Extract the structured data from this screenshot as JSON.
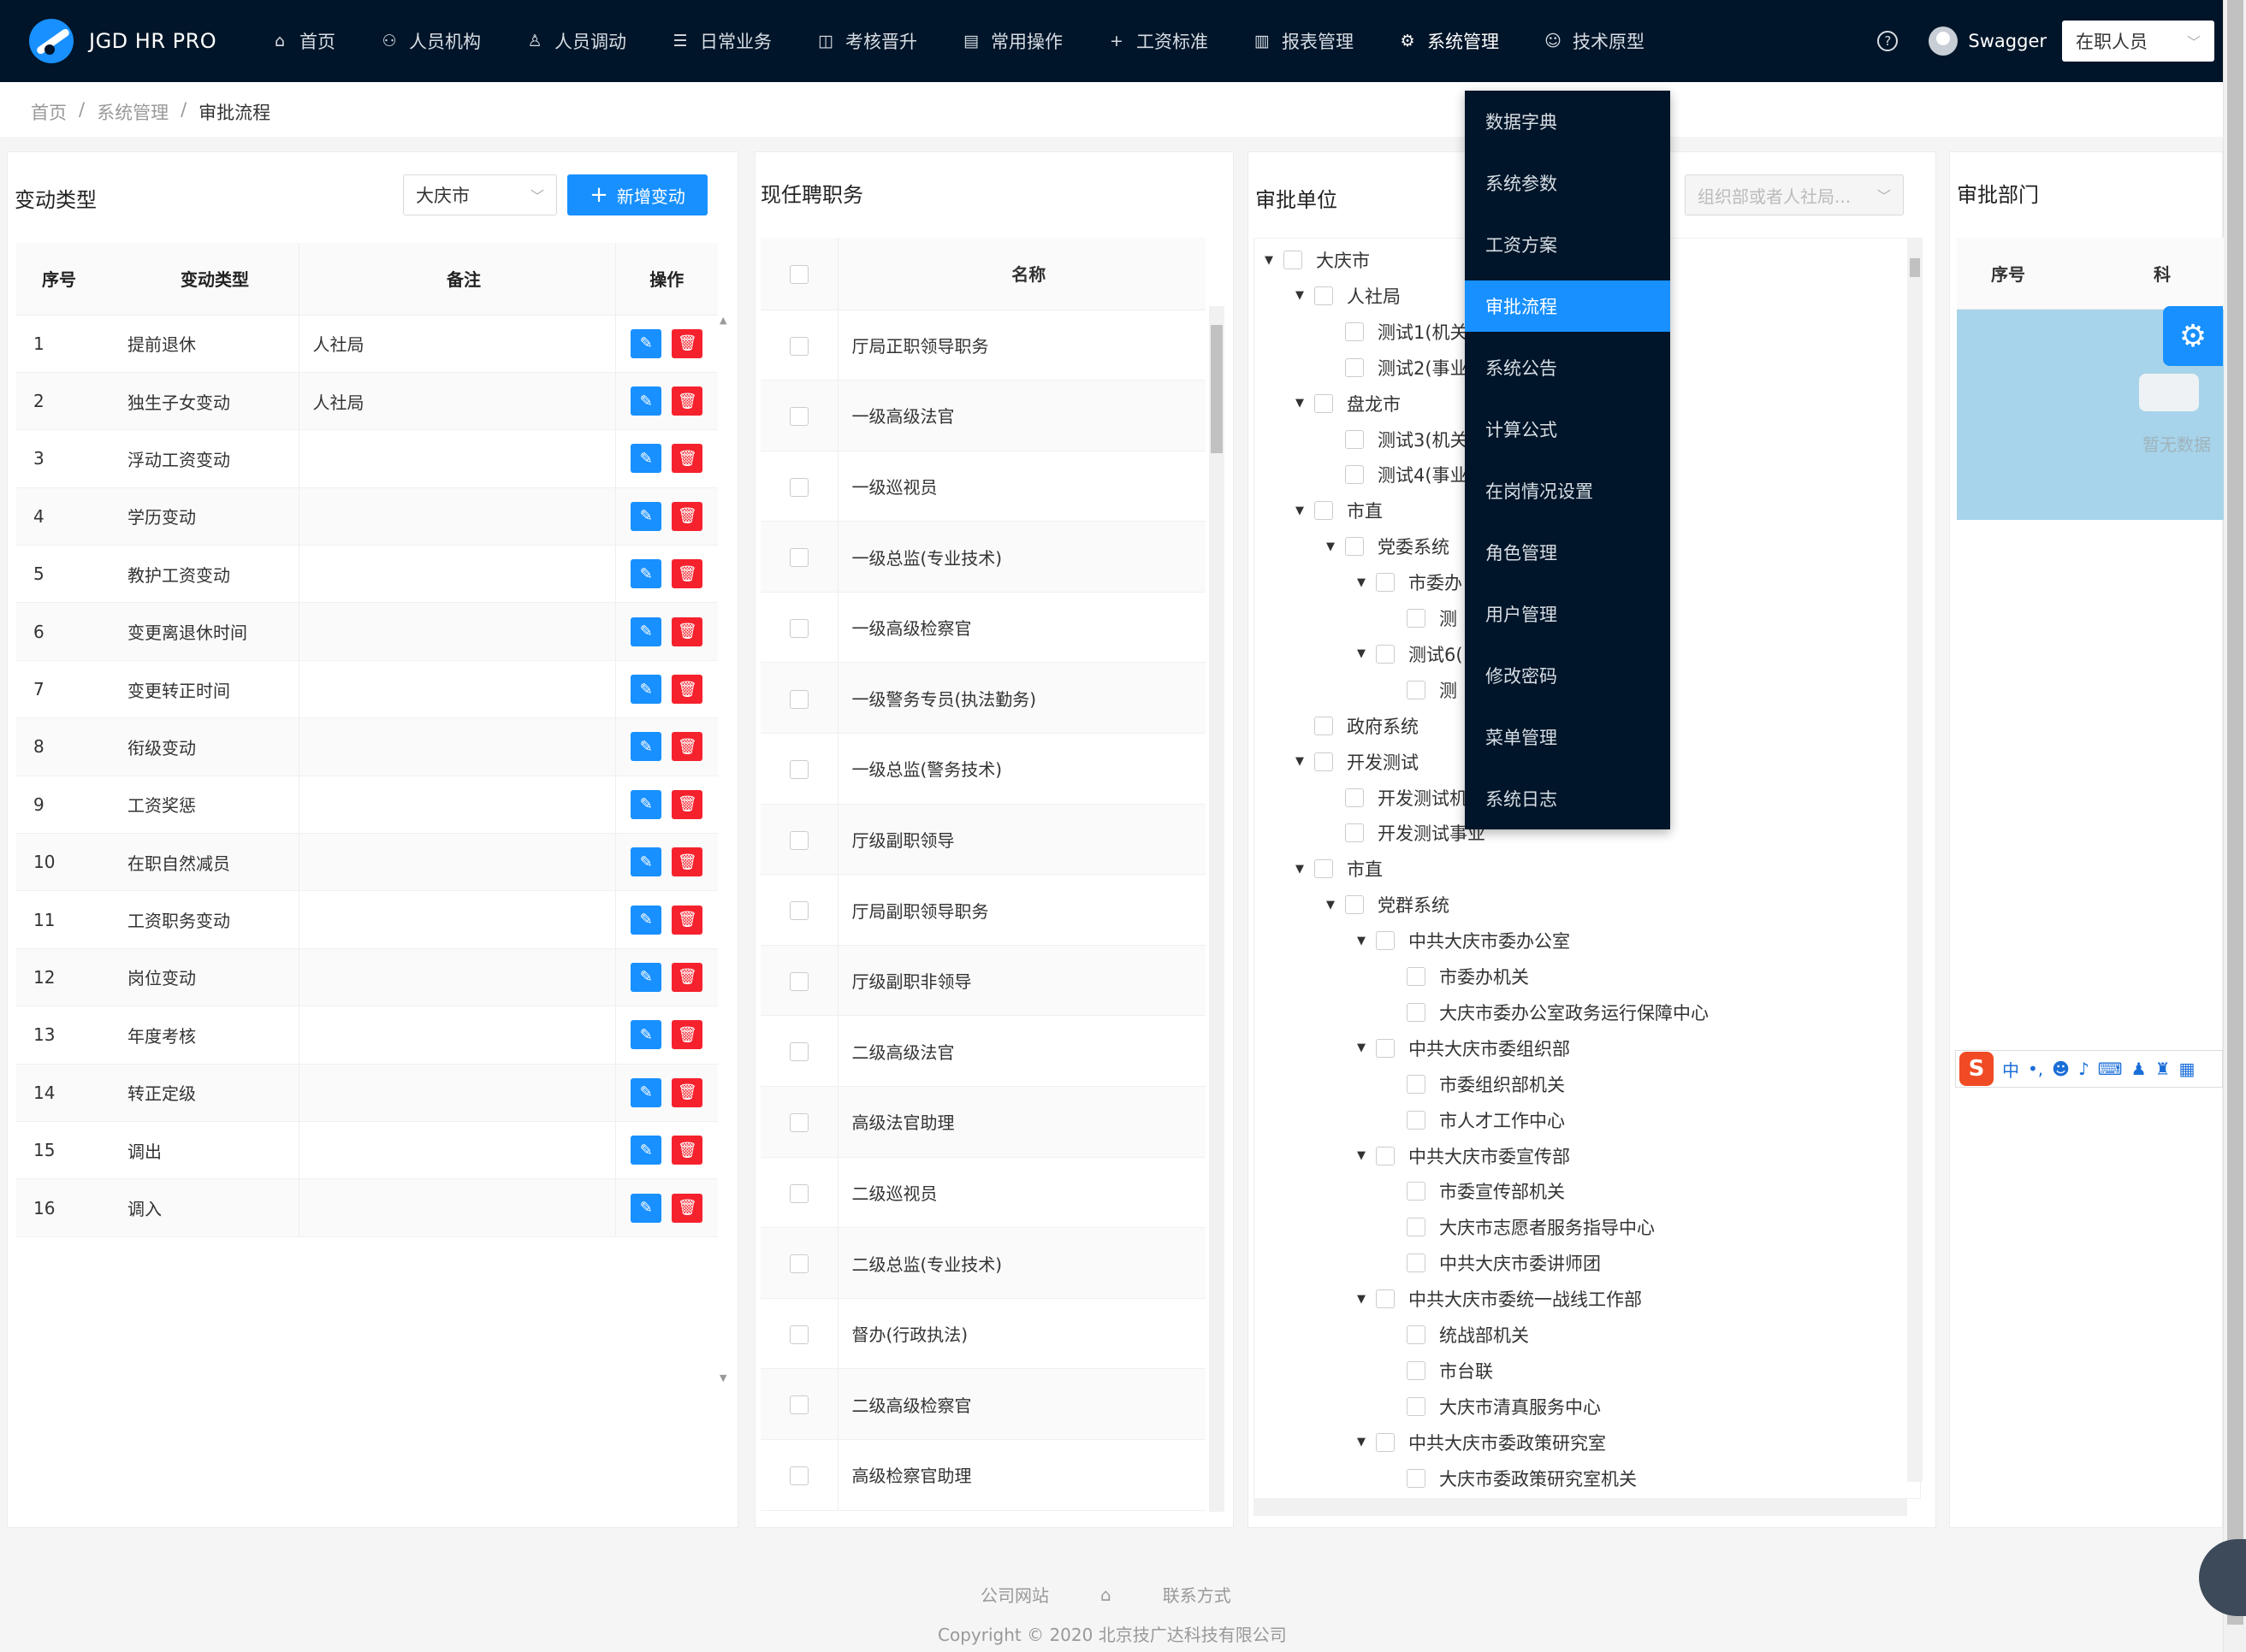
{
  "app": {
    "name": "JGD HR PRO"
  },
  "nav": [
    {
      "label": "首页",
      "icon": "home-icon",
      "glyph": "⌂"
    },
    {
      "label": "人员机构",
      "icon": "org-icon",
      "glyph": "⚇"
    },
    {
      "label": "人员调动",
      "icon": "user-icon",
      "glyph": "♙"
    },
    {
      "label": "日常业务",
      "icon": "list-icon",
      "glyph": "☰"
    },
    {
      "label": "考核晋升",
      "icon": "review-icon",
      "glyph": "◫"
    },
    {
      "label": "常用操作",
      "icon": "doc-icon",
      "glyph": "▤"
    },
    {
      "label": "工资标准",
      "icon": "plus-icon",
      "glyph": "+"
    },
    {
      "label": "报表管理",
      "icon": "chart-icon",
      "glyph": "▥"
    },
    {
      "label": "系统管理",
      "icon": "gear-icon",
      "glyph": "⚙"
    },
    {
      "label": "技术原型",
      "icon": "smile-icon",
      "glyph": "☺"
    }
  ],
  "user": {
    "name": "Swagger",
    "status": "在职人员"
  },
  "breadcrumb": [
    "首页",
    "/",
    "系统管理",
    "/",
    "审批流程"
  ],
  "panel1": {
    "title": "变动类型",
    "city": "大庆市",
    "add_label": "新增变动",
    "columns": [
      "序号",
      "变动类型",
      "备注",
      "操作"
    ],
    "rows": [
      {
        "no": "1",
        "type": "提前退休",
        "remark": "人社局"
      },
      {
        "no": "2",
        "type": "独生子女变动",
        "remark": "人社局"
      },
      {
        "no": "3",
        "type": "浮动工资变动",
        "remark": ""
      },
      {
        "no": "4",
        "type": "学历变动",
        "remark": ""
      },
      {
        "no": "5",
        "type": "教护工资变动",
        "remark": ""
      },
      {
        "no": "6",
        "type": "变更离退休时间",
        "remark": ""
      },
      {
        "no": "7",
        "type": "变更转正时间",
        "remark": ""
      },
      {
        "no": "8",
        "type": "衔级变动",
        "remark": ""
      },
      {
        "no": "9",
        "type": "工资奖惩",
        "remark": ""
      },
      {
        "no": "10",
        "type": "在职自然减员",
        "remark": ""
      },
      {
        "no": "11",
        "type": "工资职务变动",
        "remark": ""
      },
      {
        "no": "12",
        "type": "岗位变动",
        "remark": ""
      },
      {
        "no": "13",
        "type": "年度考核",
        "remark": ""
      },
      {
        "no": "14",
        "type": "转正定级",
        "remark": ""
      },
      {
        "no": "15",
        "type": "调出",
        "remark": ""
      },
      {
        "no": "16",
        "type": "调入",
        "remark": ""
      }
    ]
  },
  "panel2": {
    "title": "现任聘职务",
    "column": "名称",
    "rows": [
      "厅局正职领导职务",
      "一级高级法官",
      "一级巡视员",
      "一级总监(专业技术)",
      "一级高级检察官",
      "一级警务专员(执法勤务)",
      "一级总监(警务技术)",
      "厅级副职领导",
      "厅局副职领导职务",
      "厅级副职非领导",
      "二级高级法官",
      "高级法官助理",
      "二级巡视员",
      "二级总监(专业技术)",
      "督办(行政执法)",
      "二级高级检察官",
      "高级检察官助理"
    ]
  },
  "panel3": {
    "title": "审批单位",
    "org_placeholder": "组织部或者人社局...",
    "tree": [
      {
        "label": "大庆市",
        "level": 0,
        "caret": true
      },
      {
        "label": "人社局",
        "level": 1,
        "caret": true
      },
      {
        "label": "测试1(机关",
        "level": 2,
        "caret": false
      },
      {
        "label": "测试2(事业",
        "level": 2,
        "caret": false
      },
      {
        "label": "盘龙市",
        "level": 1,
        "caret": true
      },
      {
        "label": "测试3(机关",
        "level": 2,
        "caret": false
      },
      {
        "label": "测试4(事业",
        "level": 2,
        "caret": false
      },
      {
        "label": "市直",
        "level": 1,
        "caret": true
      },
      {
        "label": "党委系统",
        "level": 2,
        "caret": true
      },
      {
        "label": "市委办",
        "level": 3,
        "caret": true
      },
      {
        "label": "测",
        "level": 4,
        "caret": false
      },
      {
        "label": "测试6(",
        "level": 3,
        "caret": true
      },
      {
        "label": "测",
        "level": 4,
        "caret": false
      },
      {
        "label": "政府系统",
        "level": 1,
        "caret": false
      },
      {
        "label": "开发测试",
        "level": 1,
        "caret": true
      },
      {
        "label": "开发测试机",
        "level": 2,
        "caret": false
      },
      {
        "label": "开发测试事业",
        "level": 2,
        "caret": false
      },
      {
        "label": "市直",
        "level": 1,
        "caret": true
      },
      {
        "label": "党群系统",
        "level": 2,
        "caret": true
      },
      {
        "label": "中共大庆市委办公室",
        "level": 3,
        "caret": true
      },
      {
        "label": "市委办机关",
        "level": 4,
        "caret": false
      },
      {
        "label": "大庆市委办公室政务运行保障中心",
        "level": 4,
        "caret": false
      },
      {
        "label": "中共大庆市委组织部",
        "level": 3,
        "caret": true
      },
      {
        "label": "市委组织部机关",
        "level": 4,
        "caret": false
      },
      {
        "label": "市人才工作中心",
        "level": 4,
        "caret": false
      },
      {
        "label": "中共大庆市委宣传部",
        "level": 3,
        "caret": true
      },
      {
        "label": "市委宣传部机关",
        "level": 4,
        "caret": false
      },
      {
        "label": "大庆市志愿者服务指导中心",
        "level": 4,
        "caret": false
      },
      {
        "label": "中共大庆市委讲师团",
        "level": 4,
        "caret": false
      },
      {
        "label": "中共大庆市委统一战线工作部",
        "level": 3,
        "caret": true
      },
      {
        "label": "统战部机关",
        "level": 4,
        "caret": false
      },
      {
        "label": "市台联",
        "level": 4,
        "caret": false
      },
      {
        "label": "大庆市清真服务中心",
        "level": 4,
        "caret": false
      },
      {
        "label": "中共大庆市委政策研究室",
        "level": 3,
        "caret": true
      },
      {
        "label": "大庆市委政策研究室机关",
        "level": 4,
        "caret": false
      }
    ]
  },
  "panel4": {
    "title": "审批部门",
    "columns": [
      "序号",
      "科"
    ],
    "empty_text": "暂无数据"
  },
  "dropdown": [
    {
      "label": "数据字典",
      "active": false
    },
    {
      "label": "系统参数",
      "active": false
    },
    {
      "label": "工资方案",
      "active": false
    },
    {
      "label": "审批流程",
      "active": true
    },
    {
      "label": "系统公告",
      "active": false
    },
    {
      "label": "计算公式",
      "active": false
    },
    {
      "label": "在岗情况设置",
      "active": false
    },
    {
      "label": "角色管理",
      "active": false
    },
    {
      "label": "用户管理",
      "active": false
    },
    {
      "label": "修改密码",
      "active": false
    },
    {
      "label": "菜单管理",
      "active": false
    },
    {
      "label": "系统日志",
      "active": false
    }
  ],
  "ime": {
    "mode": "中",
    "punct": "•,"
  },
  "footer": {
    "link1": "公司网站",
    "link2": "联系方式",
    "copyright": "Copyright © 2020 北京技广达科技有限公司"
  },
  "colors": {
    "nav_bg": "#001529",
    "primary": "#1890ff",
    "danger": "#f5222d"
  }
}
